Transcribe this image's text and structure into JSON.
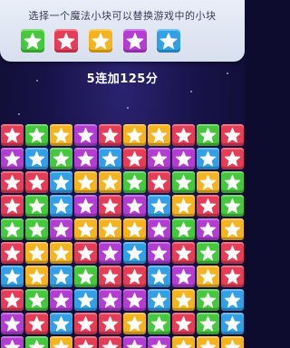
{
  "prompt_text": "选择一个魔法小块可以替换游戏中的小块",
  "score_text": "5连加125分",
  "colors": {
    "green": "#46c83c",
    "red": "#e63c55",
    "yellow": "#f5b41e",
    "purple": "#b43cd2",
    "blue": "#32a0e6",
    "star": "#ffffff"
  },
  "star_icon": "star-icon",
  "choices": [
    {
      "color": "green",
      "label": "green-block"
    },
    {
      "color": "red",
      "label": "red-block"
    },
    {
      "color": "yellow",
      "label": "yellow-block"
    },
    {
      "color": "purple",
      "label": "purple-block"
    },
    {
      "color": "blue",
      "label": "blue-block"
    }
  ],
  "board": [
    [
      "R",
      "G",
      "Y",
      "P",
      "R",
      "Y",
      "Y",
      "R",
      "G",
      "R"
    ],
    [
      "P",
      "B",
      "G",
      "P",
      "B",
      "R",
      "P",
      "P",
      "B",
      "R"
    ],
    [
      "R",
      "R",
      "B",
      "Y",
      "Y",
      "G",
      "R",
      "G",
      "Y",
      "G"
    ],
    [
      "R",
      "G",
      "B",
      "P",
      "R",
      "P",
      "B",
      "Y",
      "R",
      "G"
    ],
    [
      "G",
      "G",
      "P",
      "Y",
      "Y",
      "Y",
      "P",
      "G",
      "P",
      "Y"
    ],
    [
      "R",
      "Y",
      "Y",
      "R",
      "P",
      "B",
      "P",
      "R",
      "G",
      "R"
    ],
    [
      "B",
      "Y",
      "B",
      "G",
      "R",
      "R",
      "B",
      "P",
      "Y",
      "R"
    ],
    [
      "R",
      "G",
      "P",
      "B",
      "P",
      "P",
      "B",
      "Y",
      "G",
      "B"
    ],
    [
      "P",
      "R",
      "B",
      "R",
      "R",
      "Y",
      "G",
      "R",
      "G",
      "B"
    ],
    [
      "P",
      "G",
      "Y",
      "R",
      "R",
      "P",
      "P",
      "Y",
      "Y",
      "Y"
    ]
  ]
}
